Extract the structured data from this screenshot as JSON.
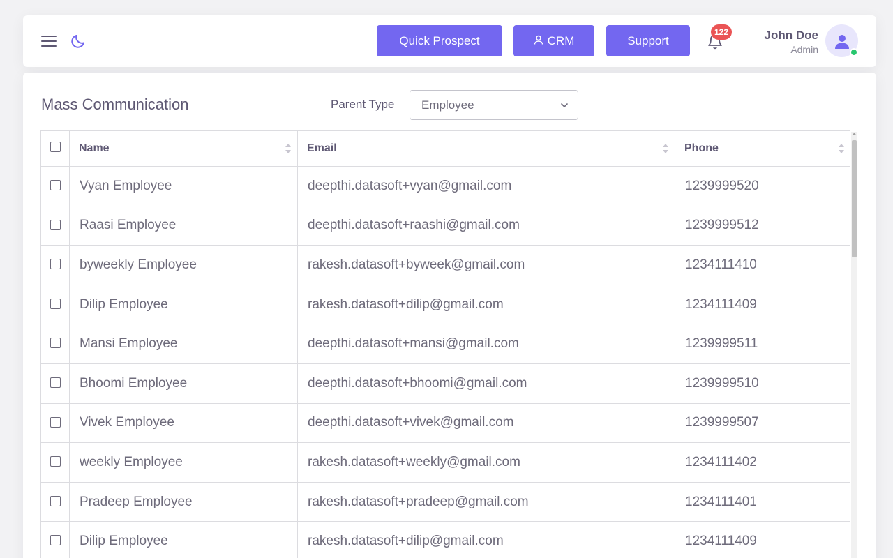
{
  "header": {
    "menu_icon": "hamburger-menu-icon",
    "theme_icon": "moon-icon",
    "buttons": {
      "quick_prospect": "Quick Prospect",
      "crm": "CRM",
      "support": "Support"
    },
    "notifications_count": "122",
    "user": {
      "name": "John Doe",
      "role": "Admin"
    },
    "colors": {
      "accent": "#7367f0",
      "badge": "#ea5455",
      "online": "#28c76f"
    }
  },
  "page": {
    "title": "Mass Communication",
    "parent_type_label": "Parent Type",
    "parent_type_value": "Employee"
  },
  "table": {
    "columns": [
      "Name",
      "Email",
      "Phone"
    ],
    "rows": [
      {
        "name": "Vyan Employee",
        "email": "deepthi.datasoft+vyan@gmail.com",
        "phone": "1239999520"
      },
      {
        "name": "Raasi Employee",
        "email": "deepthi.datasoft+raashi@gmail.com",
        "phone": "1239999512"
      },
      {
        "name": "byweekly Employee",
        "email": "rakesh.datasoft+byweek@gmail.com",
        "phone": "1234111410"
      },
      {
        "name": "Dilip Employee",
        "email": "rakesh.datasoft+dilip@gmail.com",
        "phone": "1234111409"
      },
      {
        "name": "Mansi Employee",
        "email": "deepthi.datasoft+mansi@gmail.com",
        "phone": "1239999511"
      },
      {
        "name": "Bhoomi Employee",
        "email": "deepthi.datasoft+bhoomi@gmail.com",
        "phone": "1239999510"
      },
      {
        "name": "Vivek Employee",
        "email": "deepthi.datasoft+vivek@gmail.com",
        "phone": "1239999507"
      },
      {
        "name": "weekly Employee",
        "email": "rakesh.datasoft+weekly@gmail.com",
        "phone": "1234111402"
      },
      {
        "name": "Pradeep Employee",
        "email": "rakesh.datasoft+pradeep@gmail.com",
        "phone": "1234111401"
      },
      {
        "name": "Dilip Employee",
        "email": "rakesh.datasoft+dilip@gmail.com",
        "phone": "1234111409"
      }
    ]
  }
}
